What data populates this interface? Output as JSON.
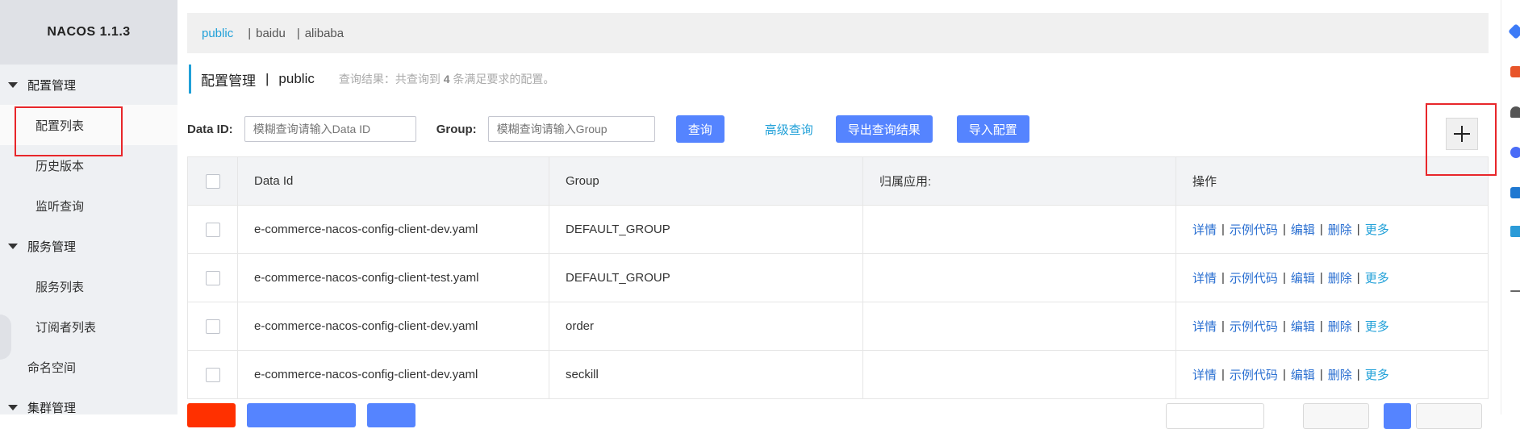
{
  "app": {
    "title": "NACOS 1.1.3"
  },
  "sidebar": {
    "groups": [
      {
        "label": "配置管理",
        "items": [
          "配置列表",
          "历史版本",
          "监听查询"
        ]
      },
      {
        "label": "服务管理",
        "items": [
          "服务列表",
          "订阅者列表"
        ]
      }
    ],
    "namespace_label": "命名空间",
    "cluster_label": "集群管理"
  },
  "namespaces": [
    "public",
    "baidu",
    "alibaba"
  ],
  "namespace_sep": "|",
  "page": {
    "title": "配置管理",
    "bar": "|",
    "ns": "public",
    "result_prefix": "查询结果：共查询到",
    "result_count": "4",
    "result_suffix": "条满足要求的配置。"
  },
  "filters": {
    "data_id_label": "Data ID:",
    "data_id_placeholder": "模糊查询请输入Data ID",
    "group_label": "Group:",
    "group_placeholder": "模糊查询请输入Group",
    "query_button": "查询",
    "advanced_query": "高级查询",
    "export_button": "导出查询结果",
    "import_button": "导入配置"
  },
  "add_button_glyph": "+",
  "table": {
    "columns": [
      "Data Id",
      "Group",
      "归属应用:",
      "操作"
    ],
    "rows": [
      {
        "data_id": "e-commerce-nacos-config-client-dev.yaml",
        "group": "DEFAULT_GROUP",
        "app": ""
      },
      {
        "data_id": "e-commerce-nacos-config-client-test.yaml",
        "group": "DEFAULT_GROUP",
        "app": ""
      },
      {
        "data_id": "e-commerce-nacos-config-client-dev.yaml",
        "group": "order",
        "app": ""
      },
      {
        "data_id": "e-commerce-nacos-config-client-dev.yaml",
        "group": "seckill",
        "app": ""
      }
    ],
    "actions": [
      "详情",
      "示例代码",
      "编辑",
      "删除",
      "更多"
    ],
    "action_sep": "|"
  },
  "colors": {
    "accent": "#20a0d8",
    "primary_button": "#5584ff",
    "danger_button": "#ff3000",
    "highlight_box": "#e8262a",
    "action_link": "#2a6fd1"
  }
}
